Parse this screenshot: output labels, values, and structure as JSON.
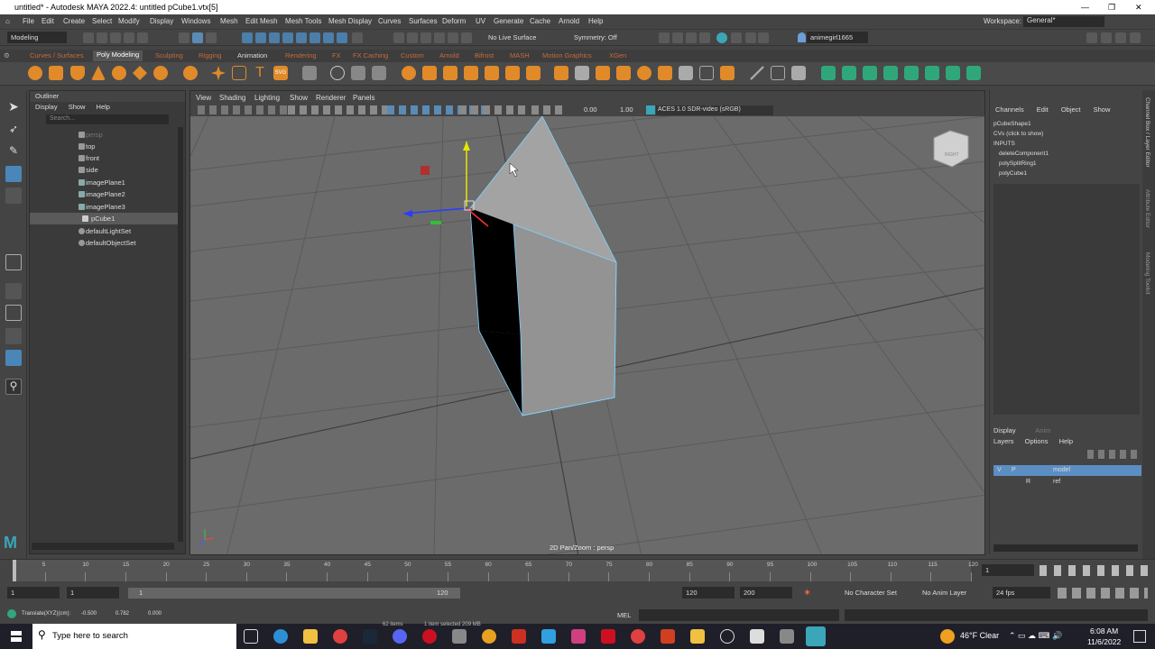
{
  "title": {
    "app": "untitled* - Autodesk MAYA 2022.4: untitled",
    "selection": "pCube1.vtx[5]"
  },
  "menubar": [
    "File",
    "Edit",
    "Create",
    "Select",
    "Modify",
    "Display",
    "Windows",
    "Mesh",
    "Edit Mesh",
    "Mesh Tools",
    "Mesh Display",
    "Curves",
    "Surfaces",
    "Deform",
    "UV",
    "Generate",
    "Cache",
    "Arnold",
    "Help"
  ],
  "workspace": {
    "label": "Workspace:",
    "value": "General*"
  },
  "status": {
    "menuset": "Modeling",
    "live": "No Live Surface",
    "symmetry": "Symmetry: Off",
    "user": "animegirl1665"
  },
  "shelf_tabs": [
    "Curves / Surfaces",
    "Poly Modeling",
    "Sculpting",
    "Rigging",
    "Animation",
    "Rendering",
    "FX",
    "FX Caching",
    "Custom",
    "Arnold",
    "Bifrost",
    "MASH",
    "Motion Graphics",
    "XGen"
  ],
  "outliner": {
    "title": "Outliner",
    "menus": [
      "Display",
      "Show",
      "Help"
    ],
    "search": "Search...",
    "items": [
      "persp",
      "top",
      "front",
      "side",
      "imagePlane1",
      "imagePlane2",
      "imagePlane3",
      "pCube1",
      "defaultLightSet",
      "defaultObjectSet"
    ]
  },
  "viewport": {
    "menus": [
      "View",
      "Shading",
      "Lighting",
      "Show",
      "Renderer",
      "Panels"
    ],
    "exposure": "0.00",
    "gamma": "1.00",
    "colorspace": "ACES 1.0 SDR-video (sRGB)",
    "hud": "2D Pan/Zoom : persp",
    "cube": "RIGHT"
  },
  "channelbox": {
    "menus": [
      "Channels",
      "Edit",
      "Object",
      "Show"
    ],
    "shape": "pCubeShape1",
    "cvs": "CVs (click to show)",
    "inputs": "INPUTS",
    "history": [
      "deleteComponent1",
      "polySplitRing1",
      "polyCube1"
    ]
  },
  "layers": {
    "tabs": [
      "Display",
      "Anim"
    ],
    "menus": [
      "Layers",
      "Options",
      "Help"
    ],
    "rows": [
      {
        "v": "V",
        "p": "P",
        "name": "model"
      },
      {
        "v": "",
        "p": "R",
        "name": "ref"
      }
    ]
  },
  "side_tabs": [
    "Channel Box / Layer Editor",
    "Attribute Editor",
    "Modeling Toolkit"
  ],
  "timeline": {
    "ticks": [
      "1",
      "5",
      "10",
      "15",
      "20",
      "25",
      "30",
      "35",
      "40",
      "45",
      "50",
      "55",
      "60",
      "65",
      "70",
      "75",
      "80",
      "85",
      "90",
      "95",
      "100",
      "105",
      "110",
      "115",
      "120"
    ],
    "current": "1"
  },
  "range": {
    "start": "1",
    "inner_start": "1",
    "slider_start": "1",
    "slider_end": "120",
    "end": "120",
    "max": "200",
    "charset": "No Character Set",
    "animlayer": "No Anim Layer",
    "fps": "24 fps"
  },
  "cmd": {
    "help": "Translate(XYZ)(cm):",
    "x": "-0.500",
    "y": "0.782",
    "z": "0.000",
    "lang": "MEL",
    "selinfo1": "62 items",
    "selinfo2": "1 item selected  209 MB"
  },
  "taskbar": {
    "search": "Type here to search",
    "weather": "46°F  Clear",
    "time": "6:08 AM",
    "date": "11/6/2022"
  }
}
